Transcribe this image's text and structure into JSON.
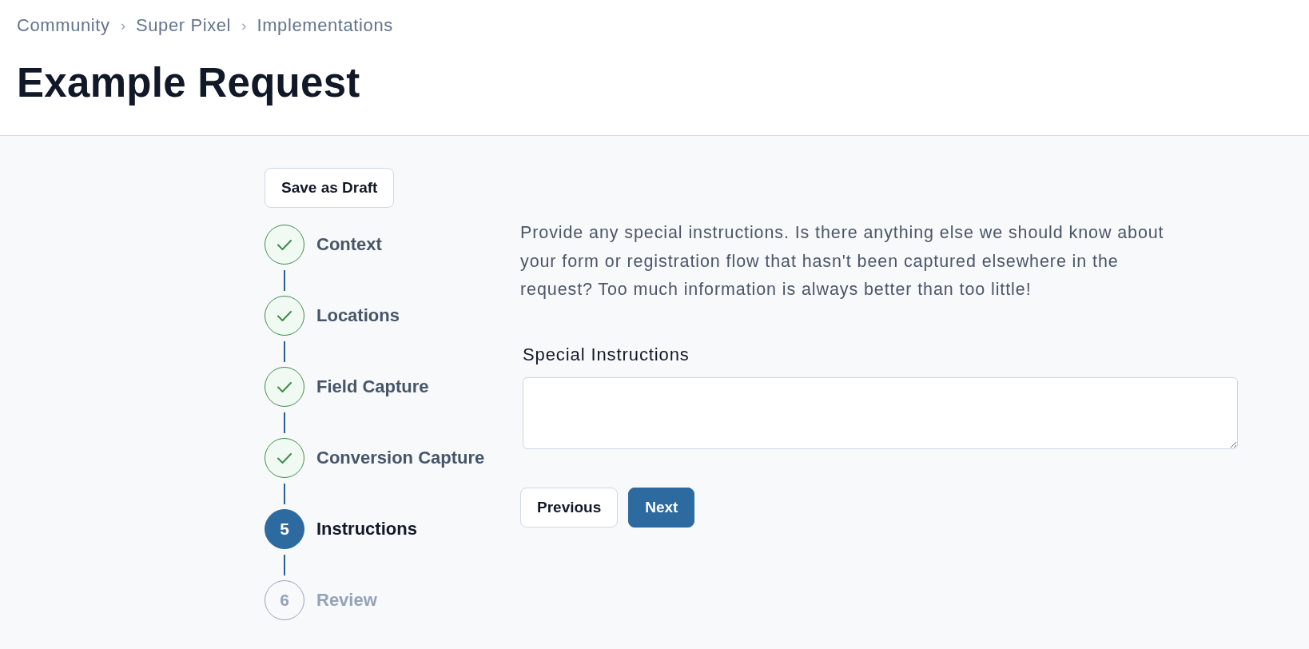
{
  "breadcrumb": [
    {
      "label": "Community",
      "separator": "›"
    },
    {
      "label": "Super Pixel",
      "separator": "›"
    },
    {
      "label": "Implementations"
    }
  ],
  "page_title": "Example Request",
  "save_draft_button": "Save as Draft",
  "steps": [
    {
      "label": "Context",
      "completed": true,
      "selected": false
    },
    {
      "label": "Locations",
      "completed": true,
      "selected": false
    },
    {
      "label": "Field Capture",
      "completed": true,
      "selected": false
    },
    {
      "label": "Conversion Capture",
      "completed": true,
      "selected": false
    },
    {
      "label": "Instructions",
      "number": "5",
      "completed": false,
      "selected": true
    },
    {
      "label": "Review",
      "number": "6",
      "completed": false,
      "selected": false
    }
  ],
  "instructions": "Provide any special instructions. Is there anything else we should know about your form or registration flow that hasn't been captured elsewhere in the request? Too much information is always better than too little!",
  "field": {
    "label": "Special Instructions"
  },
  "buttons": [
    {
      "label": "Previous",
      "kind": "secondary"
    },
    {
      "label": "Next",
      "kind": "primary"
    }
  ]
}
